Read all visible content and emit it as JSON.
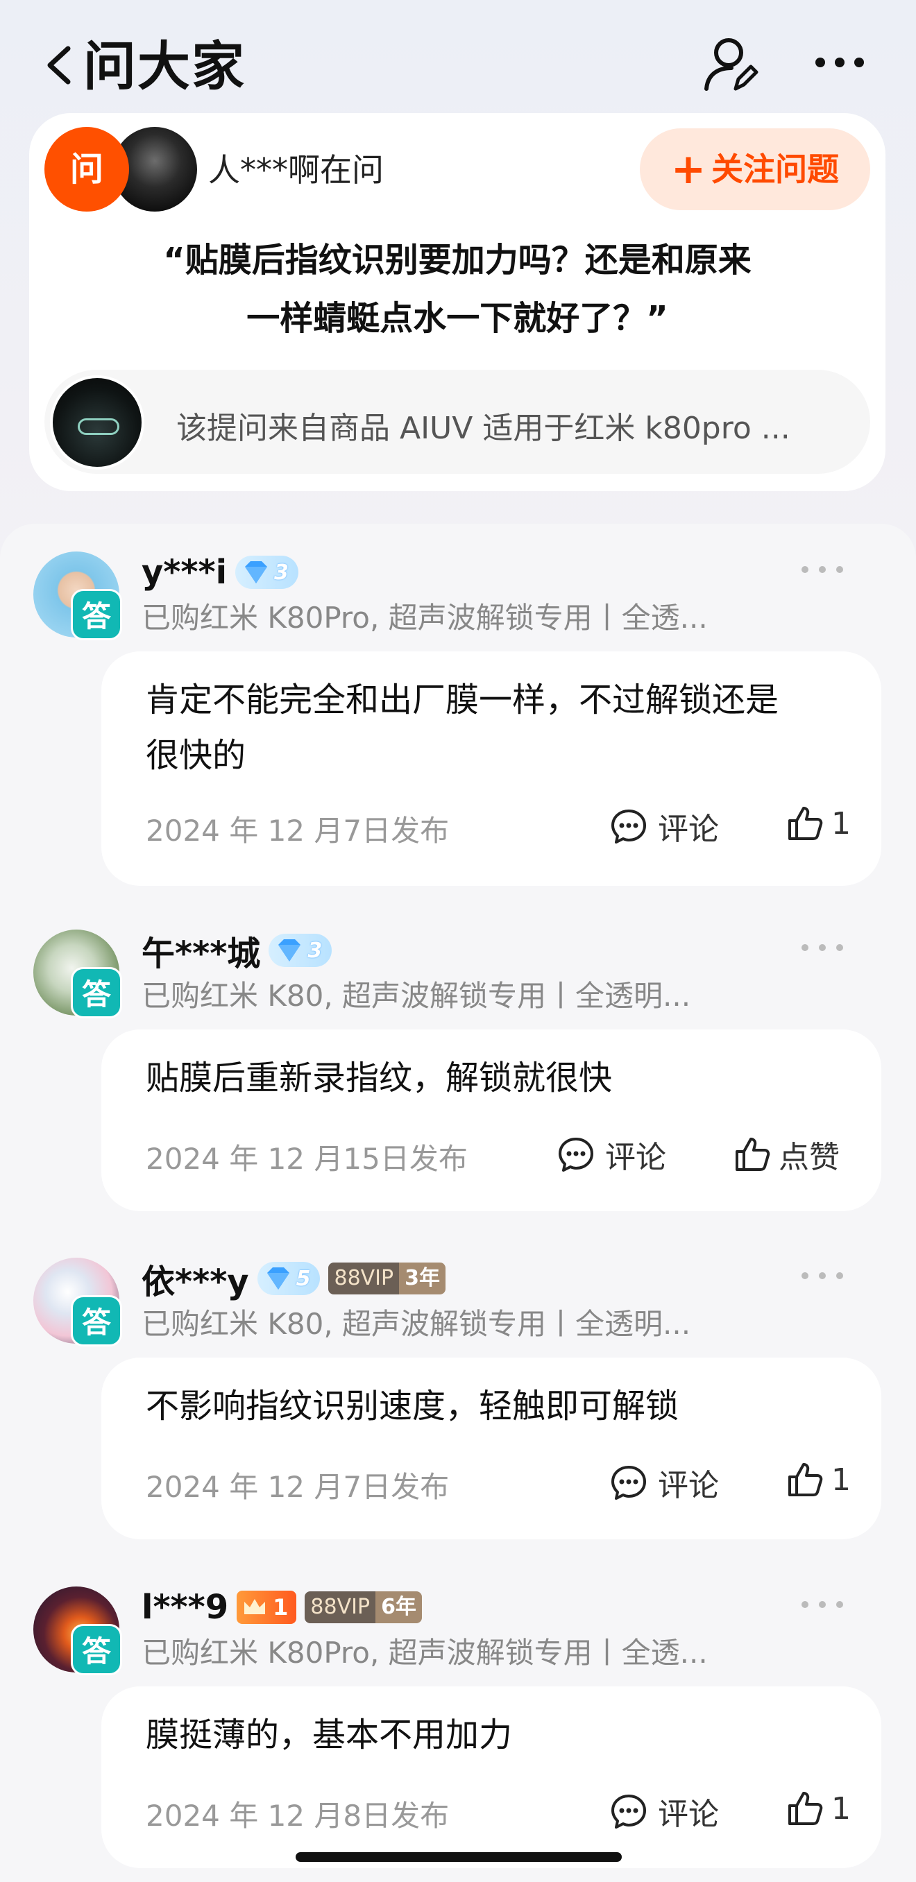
{
  "header": {
    "title": "问大家"
  },
  "question": {
    "badge": "问",
    "asker": "人***啊在问",
    "follow_label": "关注问题",
    "follow_plus": "+",
    "text_line1": "“贴膜后指纹识别要加力吗？还是和原来",
    "text_line2": "一样蜻蜓点水一下就好了？”",
    "product_text": "该提问来自商品 AIUV 适用于红米 k80pro ..."
  },
  "answers": [
    {
      "name": "y***i",
      "badge": "答",
      "diamond_level": "3",
      "purchase": "已购红米 K80Pro, 超声波解锁专用丨全透...",
      "text_line1": "肯定不能完全和出厂膜一样，不过解锁还是",
      "text_line2": "很快的",
      "date": "2024 年 12 月7日发布",
      "comment_label": "评论",
      "like_label": "1"
    },
    {
      "name": "午***城",
      "badge": "答",
      "diamond_level": "3",
      "purchase": "已购红米 K80, 超声波解锁专用丨全透明...",
      "text_line1": "贴膜后重新录指纹，解锁就很快",
      "date": "2024 年 12 月15日发布",
      "comment_label": "评论",
      "like_label": "点赞"
    },
    {
      "name": "依***y",
      "badge": "答",
      "diamond_level": "5",
      "vip_label": "88VIP",
      "vip_years": "3年",
      "purchase": "已购红米 K80, 超声波解锁专用丨全透明...",
      "text_line1": "不影响指纹识别速度，轻触即可解锁",
      "date": "2024 年 12 月7日发布",
      "comment_label": "评论",
      "like_label": "1"
    },
    {
      "name": "l***9",
      "badge": "答",
      "crown_level": "1",
      "vip_label": "88VIP",
      "vip_years": "6年",
      "purchase": "已购红米 K80Pro, 超声波解锁专用丨全透...",
      "text_line1": "膜挺薄的，基本不用加力",
      "date": "2024 年 12 月8日发布",
      "comment_label": "评论",
      "like_label": "1"
    }
  ],
  "icons": {
    "back": "chevron-left-icon",
    "profile": "user-edit-icon",
    "more": "more-dots-icon",
    "comment": "comment-bubble-icon",
    "like": "thumbs-up-icon",
    "diamond": "diamond-icon",
    "crown": "crown-icon"
  },
  "colors": {
    "accent": "#ff5000",
    "follow_bg": "#ffe8dc",
    "answer_badge": "#11b8b4"
  }
}
